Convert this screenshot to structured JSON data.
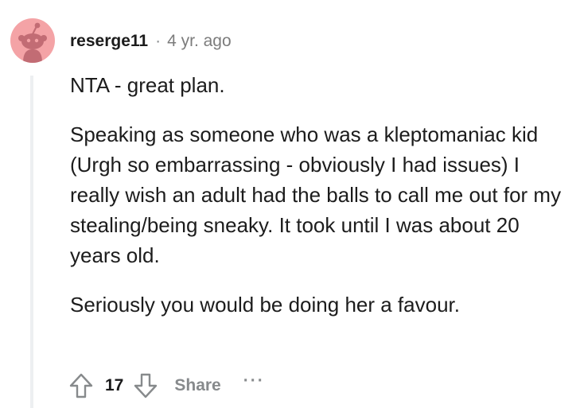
{
  "comment": {
    "author": "reserge11",
    "separator": "·",
    "age": "4 yr. ago",
    "paragraphs": [
      "NTA - great plan.",
      "Speaking as someone who was a kleptomaniac kid (Urgh so embarrassing - obviously I had issues) I really wish an adult had the balls to call me out for my stealing/being sneaky. It took until I was about 20 years old.",
      "Seriously you would be doing her a favour."
    ]
  },
  "actions": {
    "score": "17",
    "share_label": "Share",
    "more_label": "···",
    "icons": {
      "upvote": "arrow-up-icon",
      "downvote": "arrow-down-icon",
      "more": "ellipsis-icon"
    }
  },
  "colors": {
    "avatar_bg": "#f4a3a6",
    "avatar_figure": "#c26c74",
    "thread_line": "#edeff1",
    "muted_text": "#878a8c"
  }
}
